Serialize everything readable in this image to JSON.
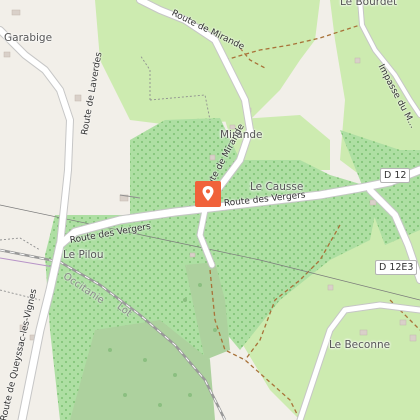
{
  "map": {
    "places": {
      "garabige": "Garabige",
      "le_bourdet": "Le Bourdet",
      "mirande": "Mirande",
      "le_causse": "Le Causse",
      "le_pilou": "Le Pilou",
      "le_beconne": "Le Beconne"
    },
    "roads": {
      "route_de_mirande_top": "Route de Mirande",
      "route_de_mirande_vertical": "Route de Mirande",
      "route_de_laverdes": "Route de Laverdes",
      "route_des_vergers_left": "Route des Vergers",
      "route_des_vergers_right": "Route des Vergers",
      "route_de_queyssac": "Route de Queyssac-les-Vignes",
      "impasse": "Impasse du M..."
    },
    "refs": {
      "d12": "D 12",
      "d12e3": "D 12E3"
    },
    "rail": {
      "occitanie": "Occitanie",
      "lot": "Lot"
    },
    "marker": {
      "icon": "map-pin-icon",
      "color": "#f0623a"
    },
    "colors": {
      "background": "#f2efe9",
      "meadow": "#cdebb0",
      "orchard": "#aedfa3",
      "forest": "#add19e",
      "road": "#ffffff",
      "road_casing": "#c6c6c6",
      "track": "#a87239",
      "rail": "#999999"
    }
  }
}
